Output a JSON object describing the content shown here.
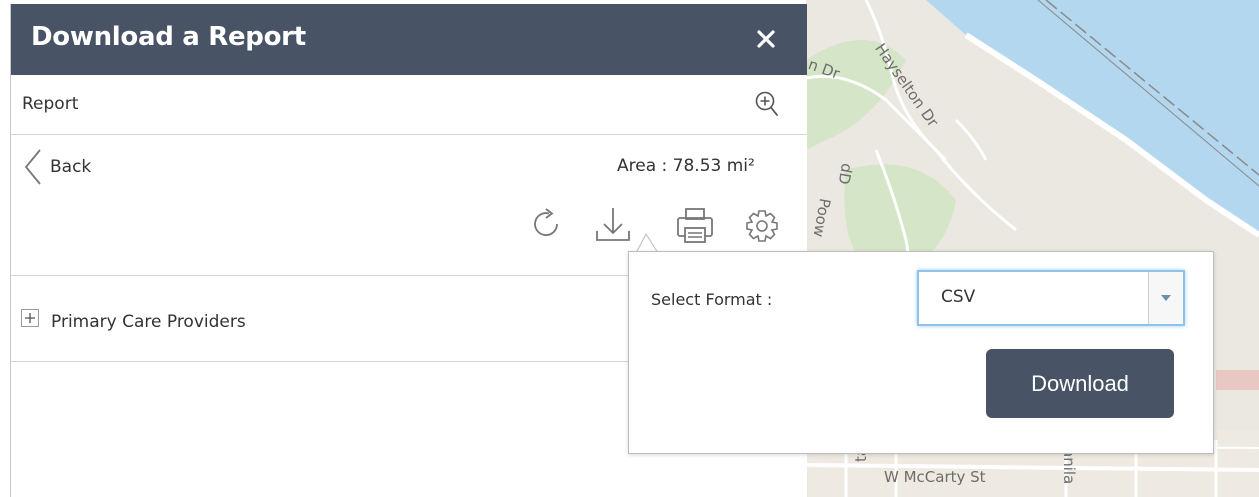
{
  "panel": {
    "title": "Download a Report",
    "close_icon": "✕",
    "report_label": "Report",
    "back_label": "Back",
    "area_text": "Area : 78.53 mi²",
    "header_color": "#485465"
  },
  "tools": [
    "refresh-icon",
    "download-icon",
    "print-icon",
    "settings-icon"
  ],
  "layers": [
    {
      "label": "Primary Care Providers",
      "expand_symbol": "+"
    }
  ],
  "popup": {
    "format_label": "Select Format :",
    "format_value": "CSV",
    "download_label": "Download"
  },
  "map": {
    "labels": [
      "Hayselton Dr",
      "n Dr",
      "Poow",
      "dD",
      "W McCarty St",
      "anila",
      "ta R"
    ]
  }
}
